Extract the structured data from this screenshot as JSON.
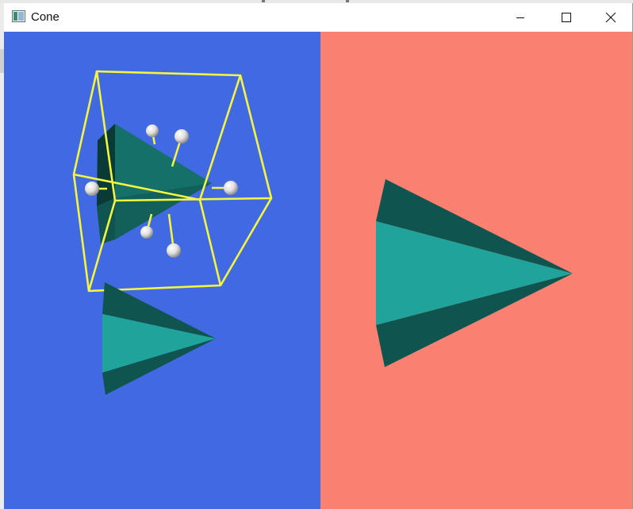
{
  "window": {
    "title": "Cone",
    "app_icon": "application-icon",
    "controls": {
      "minimize_icon": "minimize-icon",
      "maximize_icon": "maximize-icon",
      "close_icon": "close-icon"
    }
  },
  "viewports": {
    "left": {
      "background": "#4169e1"
    },
    "right": {
      "background": "#fa8072"
    }
  },
  "colors": {
    "cone_face": "#20a39a",
    "cone_shadow": "#10544f",
    "cone_dark": "#0a3a36",
    "bounding_box": "#f4f442",
    "handle": "#e6e6e6"
  }
}
